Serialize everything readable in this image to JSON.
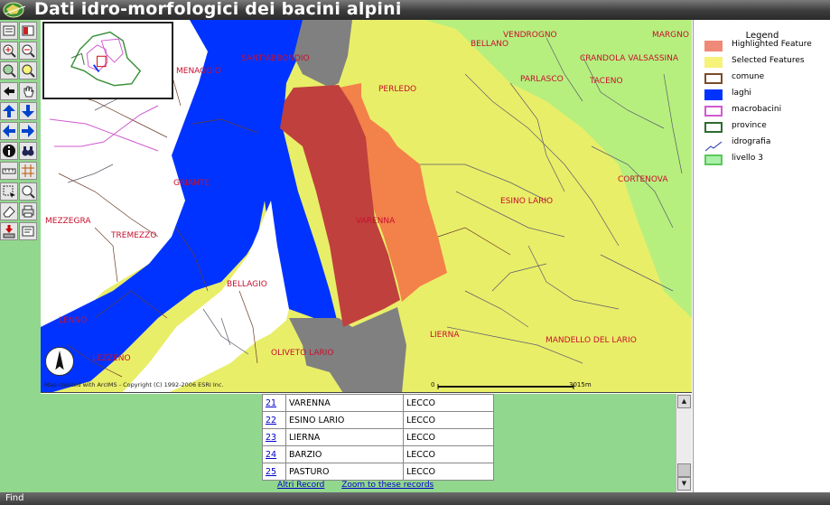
{
  "app": {
    "title": "Dati idro-morfologici dei bacini alpini",
    "logo_icon": "globe-logo-icon"
  },
  "toolbar": {
    "tools": [
      {
        "name": "toggle-legend-tool",
        "icon": "legend-icon"
      },
      {
        "name": "toggle-layers-tool",
        "icon": "layers-icon"
      },
      {
        "name": "zoom-in-tool",
        "icon": "zoom-in-icon"
      },
      {
        "name": "zoom-out-tool",
        "icon": "zoom-out-icon"
      },
      {
        "name": "zoom-full-tool",
        "icon": "zoom-full-icon"
      },
      {
        "name": "zoom-active-tool",
        "icon": "zoom-active-icon"
      },
      {
        "name": "back-tool",
        "icon": "back-icon"
      },
      {
        "name": "pan-tool",
        "icon": "hand-icon"
      },
      {
        "name": "pan-north-tool",
        "icon": "arrow-up-icon"
      },
      {
        "name": "pan-south-tool",
        "icon": "arrow-down-icon"
      },
      {
        "name": "pan-west-tool",
        "icon": "arrow-left-icon"
      },
      {
        "name": "pan-east-tool",
        "icon": "arrow-right-icon"
      },
      {
        "name": "identify-tool",
        "icon": "info-icon"
      },
      {
        "name": "find-tool",
        "icon": "binoculars-icon"
      },
      {
        "name": "measure-tool",
        "icon": "ruler-icon"
      },
      {
        "name": "grid-tool",
        "icon": "grid-icon"
      },
      {
        "name": "select-rect-tool",
        "icon": "select-rect-icon"
      },
      {
        "name": "select-tool",
        "icon": "select-icon"
      },
      {
        "name": "clear-tool",
        "icon": "eraser-icon"
      },
      {
        "name": "print-tool",
        "icon": "print-icon"
      },
      {
        "name": "download-tool",
        "icon": "download-icon"
      },
      {
        "name": "extract-tool",
        "icon": "extract-icon"
      }
    ]
  },
  "map": {
    "places": [
      {
        "name": "SANT'ABBONDIO"
      },
      {
        "name": "MENAGGIO"
      },
      {
        "name": "BELLANO"
      },
      {
        "name": "VENDROGNO"
      },
      {
        "name": "MARGNO"
      },
      {
        "name": "CRANDOLA VALSASSINA"
      },
      {
        "name": "PERLEDO"
      },
      {
        "name": "PARLASCO"
      },
      {
        "name": "TACENO"
      },
      {
        "name": "GRIANTE"
      },
      {
        "name": "CORTENOVA"
      },
      {
        "name": "ESINO LARIO"
      },
      {
        "name": "MEZZEGRA"
      },
      {
        "name": "VARENNA"
      },
      {
        "name": "TREMEZZO"
      },
      {
        "name": "BELLAGIO"
      },
      {
        "name": "LENNO"
      },
      {
        "name": "LIERNA"
      },
      {
        "name": "MANDELLO DEL LARIO"
      },
      {
        "name": "OLIVETO LARIO"
      },
      {
        "name": "LEZZENO"
      }
    ],
    "copyright": "Map created with ArcIMS - Copyright (C) 1992-2006 ESRI Inc.",
    "scale_start": "0",
    "scale_end": "3015m",
    "north_arrow_icon": "north-arrow-icon"
  },
  "legend": {
    "title": "Legend",
    "items": [
      {
        "label": "Highlighted Feature",
        "color": "#f08a78",
        "border": "#f08a78"
      },
      {
        "label": "Selected Features",
        "color": "#f6f27a",
        "border": "#f6f27a"
      },
      {
        "label": "comune",
        "color": "#ffffff",
        "border": "#7a4b2b"
      },
      {
        "label": "laghi",
        "color": "#0033ff",
        "border": "#0033ff"
      },
      {
        "label": "macrobacini",
        "color": "#ffffff",
        "border": "#d05bd0"
      },
      {
        "label": "province",
        "color": "#ffffff",
        "border": "#2e6b2e"
      },
      {
        "label": "idrografia",
        "color": "#ffffff",
        "border": "#ffffff"
      },
      {
        "label": "livello 3",
        "color": "#a9f0a9",
        "border": "#5cc85c"
      }
    ]
  },
  "results": {
    "rows": [
      {
        "num": "21",
        "comune": "VARENNA",
        "provincia": "LECCO"
      },
      {
        "num": "22",
        "comune": "ESINO LARIO",
        "provincia": "LECCO"
      },
      {
        "num": "23",
        "comune": "LIERNA",
        "provincia": "LECCO"
      },
      {
        "num": "24",
        "comune": "BARZIO",
        "provincia": "LECCO"
      },
      {
        "num": "25",
        "comune": "PASTURO",
        "provincia": "LECCO"
      }
    ],
    "more_link": "Altri Record",
    "zoom_link": "Zoom to these records"
  },
  "status": {
    "text": "Find"
  },
  "colors": {
    "toolbar_bg": "#92d78e",
    "lake": "#0033ff",
    "selected": "#e9ee68",
    "highlight": "#c0403d",
    "orange": "#f3814a",
    "grey": "#808080"
  }
}
